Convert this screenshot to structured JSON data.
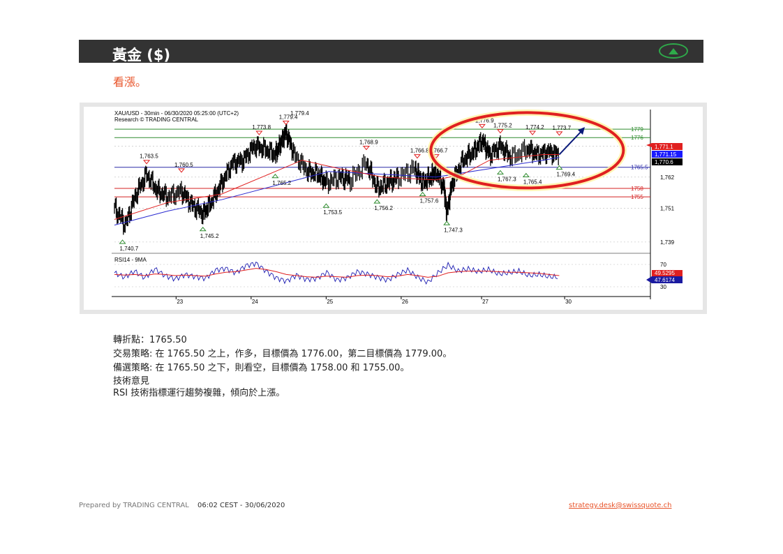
{
  "header": {
    "title": "黃金 ($)",
    "trend_icon": "up-triangle-icon",
    "trend_color": "#2eaa4a"
  },
  "subtitle": "看漲。",
  "chart_data": {
    "type": "line",
    "title": "XAU/USD - 30min - 06/30/2020 05:25:00 (UTC+2)",
    "subtitle": "Research © TRADING CENTRAL",
    "last_price_label": "1,779.4",
    "x_ticks": [
      "23",
      "24",
      "25",
      "26",
      "27",
      "30"
    ],
    "y_ticks": [
      1739,
      1751,
      1762,
      1773
    ],
    "y_tick_labels": [
      "1,739",
      "1,751",
      "1,762",
      "1,773"
    ],
    "ylim": [
      1736,
      1781
    ],
    "price_badges": [
      {
        "label": "1,771.1",
        "value": 1771.1,
        "color": "#e02020"
      },
      {
        "label": "1,771.15",
        "value": 1770.7,
        "color": "#1a1aff"
      },
      {
        "label": "1,770.6",
        "value": 1769.8,
        "color": "#000000"
      }
    ],
    "levels": [
      {
        "label": "1779",
        "value": 1779.0,
        "color": "#2e8b2e"
      },
      {
        "label": "1776",
        "value": 1776.0,
        "color": "#2e8b2e"
      },
      {
        "label": "1765.5",
        "value": 1765.5,
        "color": "#2a2aa8"
      },
      {
        "label": "1758",
        "value": 1758.0,
        "color": "#d42020"
      },
      {
        "label": "1755",
        "value": 1755.0,
        "color": "#d42020"
      }
    ],
    "highs": [
      {
        "label": "1,763.5",
        "x": 0.06,
        "value": 1765.5
      },
      {
        "label": "1,760.5",
        "x": 0.125,
        "value": 1762.5
      },
      {
        "label": "1,773.8",
        "x": 0.27,
        "value": 1775.8
      },
      {
        "label": "1,779.4",
        "x": 0.32,
        "value": 1779.4
      },
      {
        "label": "1,768.9",
        "x": 0.47,
        "value": 1770.5
      },
      {
        "label": "1,766.8",
        "x": 0.565,
        "value": 1767.5
      },
      {
        "label": "1,766.7",
        "x": 0.6,
        "value": 1767.5
      },
      {
        "label": "1,776.9",
        "x": 0.686,
        "value": 1778.2
      },
      {
        "label": "1,775.2",
        "x": 0.72,
        "value": 1776.4
      },
      {
        "label": "1,774.2",
        "x": 0.78,
        "value": 1775.8
      },
      {
        "label": "1,773.7",
        "x": 0.83,
        "value": 1775.6
      }
    ],
    "lows": [
      {
        "label": "1,740.7",
        "x": 0.015,
        "value": 1740.7
      },
      {
        "label": "1,745.2",
        "x": 0.165,
        "value": 1745.2
      },
      {
        "label": "1,765.2",
        "x": 0.3,
        "value": 1764.0
      },
      {
        "label": "1,753.5",
        "x": 0.395,
        "value": 1753.5
      },
      {
        "label": "1,756.2",
        "x": 0.49,
        "value": 1755.0
      },
      {
        "label": "1,757.6",
        "x": 0.575,
        "value": 1757.6
      },
      {
        "label": "1,747.3",
        "x": 0.62,
        "value": 1747.3
      },
      {
        "label": "1,767.3",
        "x": 0.72,
        "value": 1765.3
      },
      {
        "label": "1,765.4",
        "x": 0.768,
        "value": 1764.3
      },
      {
        "label": "1,769.4",
        "x": 0.83,
        "value": 1767.0
      }
    ],
    "close_path": [
      [
        0.0,
        1751
      ],
      [
        0.02,
        1745
      ],
      [
        0.04,
        1756
      ],
      [
        0.06,
        1763
      ],
      [
        0.08,
        1757
      ],
      [
        0.1,
        1755
      ],
      [
        0.125,
        1757
      ],
      [
        0.145,
        1752
      ],
      [
        0.165,
        1749
      ],
      [
        0.18,
        1753
      ],
      [
        0.2,
        1760
      ],
      [
        0.22,
        1767
      ],
      [
        0.24,
        1768
      ],
      [
        0.26,
        1773
      ],
      [
        0.28,
        1772
      ],
      [
        0.3,
        1770
      ],
      [
        0.31,
        1774
      ],
      [
        0.32,
        1778
      ],
      [
        0.335,
        1770
      ],
      [
        0.36,
        1764
      ],
      [
        0.38,
        1763
      ],
      [
        0.395,
        1760
      ],
      [
        0.42,
        1762
      ],
      [
        0.44,
        1761
      ],
      [
        0.47,
        1767
      ],
      [
        0.49,
        1758
      ],
      [
        0.51,
        1760
      ],
      [
        0.53,
        1762
      ],
      [
        0.56,
        1765
      ],
      [
        0.575,
        1760
      ],
      [
        0.59,
        1762
      ],
      [
        0.6,
        1764
      ],
      [
        0.615,
        1758
      ],
      [
        0.62,
        1749
      ],
      [
        0.63,
        1760
      ],
      [
        0.65,
        1768
      ],
      [
        0.67,
        1771
      ],
      [
        0.686,
        1775
      ],
      [
        0.7,
        1770
      ],
      [
        0.72,
        1773
      ],
      [
        0.74,
        1769
      ],
      [
        0.77,
        1772
      ],
      [
        0.79,
        1770
      ],
      [
        0.81,
        1771
      ],
      [
        0.83,
        1770
      ]
    ],
    "ma_path": [
      [
        0.0,
        1747
      ],
      [
        0.1,
        1753
      ],
      [
        0.2,
        1756
      ],
      [
        0.3,
        1764
      ],
      [
        0.35,
        1768
      ],
      [
        0.42,
        1765
      ],
      [
        0.5,
        1762
      ],
      [
        0.6,
        1761
      ],
      [
        0.65,
        1763
      ],
      [
        0.7,
        1768
      ],
      [
        0.8,
        1770
      ],
      [
        0.83,
        1770
      ]
    ],
    "ma2_path": [
      [
        0.0,
        1745
      ],
      [
        0.1,
        1750
      ],
      [
        0.2,
        1754
      ],
      [
        0.3,
        1759
      ],
      [
        0.4,
        1764
      ],
      [
        0.5,
        1763
      ],
      [
        0.6,
        1762
      ],
      [
        0.7,
        1765
      ],
      [
        0.8,
        1768
      ],
      [
        0.83,
        1769
      ]
    ],
    "rsi": {
      "label": "RSI14 - 9MA",
      "y_ticks": [
        70,
        30
      ],
      "badge_values": [
        "49.5295",
        "47.6174"
      ],
      "rsi_values": [
        55,
        47,
        58,
        46,
        62,
        50,
        44,
        52,
        48,
        45,
        60,
        63,
        55,
        68,
        72,
        58,
        46,
        40,
        51,
        43,
        45,
        56,
        42,
        46,
        57,
        53,
        47,
        42,
        52,
        60,
        47,
        38,
        55,
        69,
        58,
        62,
        57,
        61,
        53,
        55,
        58,
        50,
        52,
        48,
        47
      ],
      "ma_values": [
        52,
        51,
        52,
        50,
        53,
        52,
        50,
        51,
        50,
        49,
        53,
        56,
        57,
        60,
        63,
        61,
        57,
        52,
        50,
        48,
        47,
        49,
        48,
        47,
        50,
        51,
        50,
        48,
        49,
        52,
        50,
        47,
        49,
        55,
        57,
        58,
        58,
        58,
        57,
        56,
        56,
        55,
        54,
        52,
        50
      ]
    },
    "forecast_arrow_color": "#0a1a7a",
    "highlight_ellipse_color": "#e02020"
  },
  "info": {
    "pivot": "轉折點：1765.50",
    "strategy": "交易策略: 在 1765.50 之上，作多，目標價為  1776.00，第二目標價為  1779.00。",
    "alternative": "備選策略: 在 1765.50 之下，則看空，目標價為  1758.00 和 1755.00。",
    "comment_title": "技術意見",
    "comment": "RSI 技術指標運行趨勢複雜，傾向於上漲。"
  },
  "footer": {
    "prepared": "Prepared by TRADING CENTRAL",
    "timestamp": "06:02 CEST - 30/06/2020",
    "email": "strategy.desk@swissquote.ch"
  }
}
